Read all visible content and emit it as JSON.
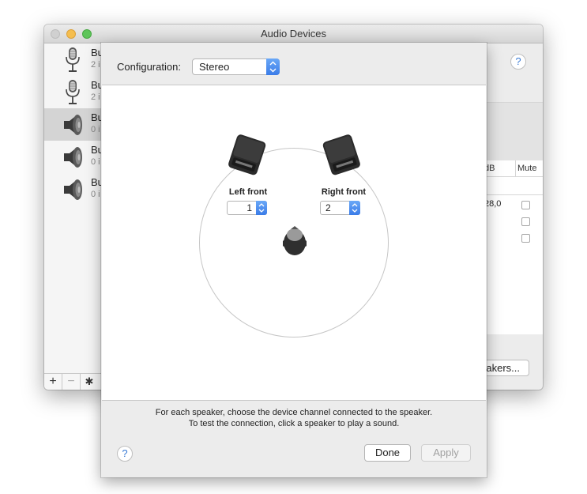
{
  "window": {
    "title": "Audio Devices"
  },
  "sidebar": {
    "items": [
      {
        "name": "Bu",
        "sub": "2 i",
        "icon": "microphone-icon",
        "selected": false
      },
      {
        "name": "Bu",
        "sub": "2 i",
        "icon": "microphone-icon",
        "selected": false
      },
      {
        "name": "Bu",
        "sub": "0 i",
        "icon": "speaker-icon",
        "selected": true
      },
      {
        "name": "Bu",
        "sub": "0 i",
        "icon": "speaker-icon",
        "selected": false
      },
      {
        "name": "Bu",
        "sub": "0 i",
        "icon": "speaker-icon",
        "selected": false
      }
    ],
    "add_label": "+",
    "remove_label": "−",
    "gear_label": "✱"
  },
  "main": {
    "help_label": "?",
    "table": {
      "db_header": "dB",
      "mute_header": "Mute",
      "db_value": "28,0"
    },
    "configure_speakers_label": "akers..."
  },
  "sheet": {
    "config_label": "Configuration:",
    "config_value": "Stereo",
    "speakers": [
      {
        "label": "Left front",
        "channel": "1"
      },
      {
        "label": "Right front",
        "channel": "2"
      }
    ],
    "instruction_line1": "For each speaker, choose the device channel connected to the speaker.",
    "instruction_line2": "To test the connection, click a speaker to play a sound.",
    "help_label": "?",
    "done_label": "Done",
    "apply_label": "Apply"
  },
  "colors": {
    "accent": "#3a7ce8",
    "selected_row": "#d4d4d4"
  }
}
